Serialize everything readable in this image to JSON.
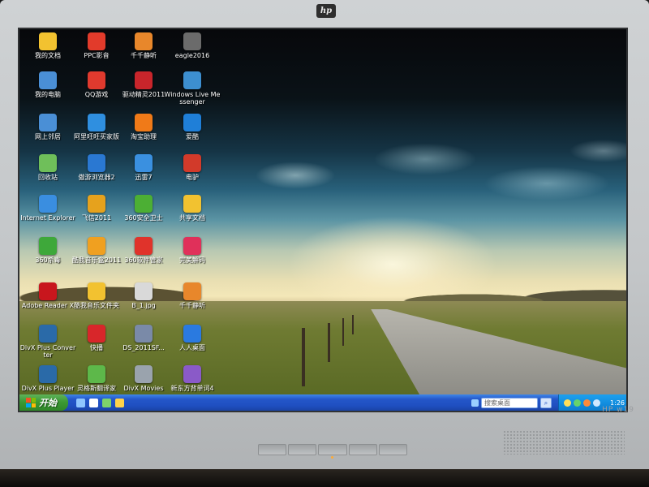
{
  "monitor": {
    "brand": "hp",
    "model": "HP w19"
  },
  "desktop_icons": [
    {
      "label": "我的文档",
      "icon": "folder-documents-icon",
      "color": "#f2c230"
    },
    {
      "label": "PPC影音",
      "icon": "ppc-player-icon",
      "color": "#e23b2b"
    },
    {
      "label": "千千静听",
      "icon": "ttplayer-icon",
      "color": "#e8872b"
    },
    {
      "label": "eagle2016",
      "icon": "app-icon",
      "color": "#6b6b6b"
    },
    {
      "label": "我的电脑",
      "icon": "my-computer-icon",
      "color": "#4a8fd6"
    },
    {
      "label": "QQ游戏",
      "icon": "qq-game-icon",
      "color": "#e03a2e"
    },
    {
      "label": "驱动精灵2011",
      "icon": "driver-genius-icon",
      "color": "#c8252b"
    },
    {
      "label": "Windows Live Messenger",
      "icon": "messenger-icon",
      "color": "#3d8fd0"
    },
    {
      "label": "网上邻居",
      "icon": "network-places-icon",
      "color": "#4a8fd6"
    },
    {
      "label": "阿里旺旺买家版",
      "icon": "aliwangwang-icon",
      "color": "#2f8fe0"
    },
    {
      "label": "淘宝助理",
      "icon": "taobao-assistant-icon",
      "color": "#f07a18"
    },
    {
      "label": "爱酷",
      "icon": "play-icon",
      "color": "#1f7fd8"
    },
    {
      "label": "回收站",
      "icon": "recycle-bin-icon",
      "color": "#6fbf5a"
    },
    {
      "label": "傲游浏览器2",
      "icon": "maxthon-icon",
      "color": "#2a78d2"
    },
    {
      "label": "迅雷7",
      "icon": "thunder-icon",
      "color": "#3a90e0"
    },
    {
      "label": "电驴",
      "icon": "emule-icon",
      "color": "#d23a2a"
    },
    {
      "label": "Internet Explorer",
      "icon": "ie-icon",
      "color": "#3a8ee0"
    },
    {
      "label": "飞信2011",
      "icon": "fetion-icon",
      "color": "#e6a21d"
    },
    {
      "label": "360安全卫士",
      "icon": "360-security-icon",
      "color": "#4caf34"
    },
    {
      "label": "共享文档",
      "icon": "shared-folder-icon",
      "color": "#f2c230"
    },
    {
      "label": "360杀毒",
      "icon": "360-antivirus-icon",
      "color": "#3ea83a"
    },
    {
      "label": "酷我音乐盒2011",
      "icon": "kuwo-icon",
      "color": "#f0a020"
    },
    {
      "label": "360软件管家",
      "icon": "360-software-icon",
      "color": "#e0332b"
    },
    {
      "label": "完美解码",
      "icon": "video-decoder-icon",
      "color": "#e0305a"
    },
    {
      "label": "Adobe Reader X",
      "icon": "adobe-reader-icon",
      "color": "#c8161d"
    },
    {
      "label": "酷我音乐文件夹",
      "icon": "folder-icon",
      "color": "#f2c230"
    },
    {
      "label": "B_1.jpg",
      "icon": "image-file-icon",
      "color": "#d9d9d9"
    },
    {
      "label": "千千静听",
      "icon": "ttplayer-icon",
      "color": "#e8872b"
    },
    {
      "label": "DivX Plus Converter",
      "icon": "divx-converter-icon",
      "color": "#2a6aa8"
    },
    {
      "label": "快播",
      "icon": "qvod-icon",
      "color": "#d8262a"
    },
    {
      "label": "DS_2011SF...",
      "icon": "game-icon",
      "color": "#7a8aa8"
    },
    {
      "label": "人人桌面",
      "icon": "renren-icon",
      "color": "#2a7ae0"
    },
    {
      "label": "DivX Plus Player",
      "icon": "divx-player-icon",
      "color": "#2a6aa8"
    },
    {
      "label": "灵格斯翻译家",
      "icon": "lingoes-icon",
      "color": "#5db84a"
    },
    {
      "label": "DivX Movies",
      "icon": "divx-movies-icon",
      "color": "#9aa3ad"
    },
    {
      "label": "新东方背单词4",
      "icon": "vocabulary-icon",
      "color": "#8a5ac8"
    }
  ],
  "taskbar": {
    "start_label": "开始",
    "search_label": "搜索桌面",
    "search_go": "⌕",
    "clock": "1:26",
    "quick_launch_colors": [
      "#8fc6ff",
      "#ffffff",
      "#7ed36a",
      "#ffd24a"
    ],
    "tray_colors": [
      "#ffdf5a",
      "#66d36b",
      "#ff8a3a",
      "#d0e8ff"
    ]
  }
}
